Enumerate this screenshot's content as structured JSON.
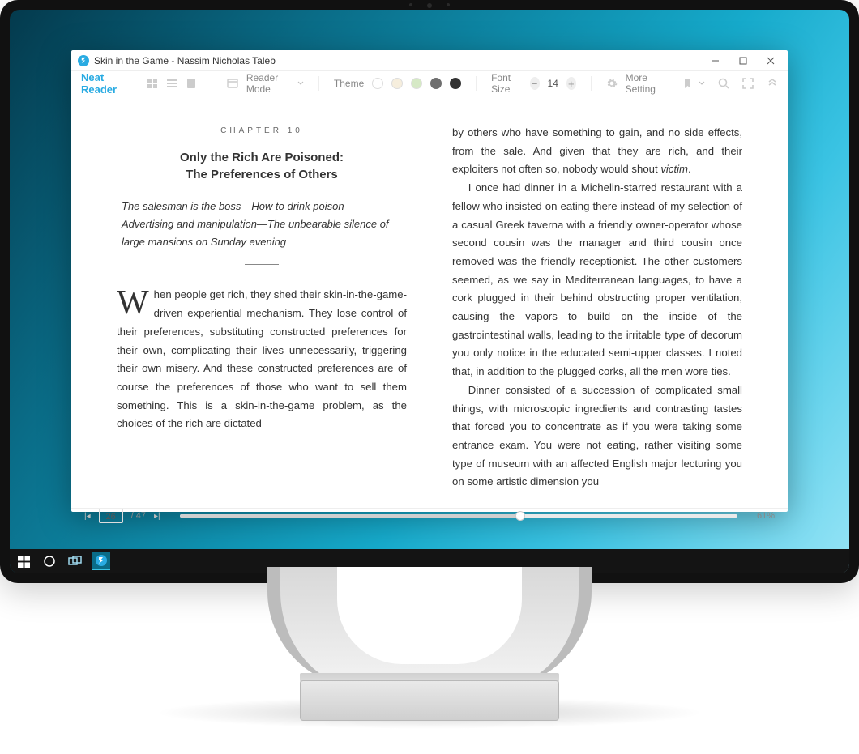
{
  "window": {
    "title": "Skin in the Game - Nassim Nicholas Taleb"
  },
  "toolbar": {
    "brand": "Neat Reader",
    "reader_mode_label": "Reader Mode",
    "theme_label": "Theme",
    "font_size_label": "Font Size",
    "font_size_value": "14",
    "more_setting_label": "More Setting",
    "theme_swatches": [
      "#ffffff",
      "#f6eedd",
      "#d6e9c6",
      "#6f6f6f",
      "#333333"
    ]
  },
  "content": {
    "chapter_label": "CHAPTER 10",
    "chapter_title_line1": "Only the Rich Are Poisoned:",
    "chapter_title_line2": "The Preferences of Others",
    "epigraph": "The salesman is the boss—How to drink poison—Advertising and manipulation—The unbearable silence of large mansions on Sunday evening",
    "dropcap": "W",
    "left_body": "hen people get rich, they shed their skin-in-the-game-driven experiential mechanism. They lose control of their preferences, substituting constructed preferences for their own, complicating their lives unnecessarily, triggering their own misery. And these constructed preferences are of course the preferences of those who want to sell them something. This is a skin-in-the-game problem, as the choices of the rich are dictated",
    "right_p1_a": "by others who have something to gain, and no side effects, from the sale. And given that they are rich, and their exploiters not often so, nobody would shout ",
    "right_p1_italic": "victim",
    "right_p1_b": ".",
    "right_p2": "I once had dinner in a Michelin-starred restaurant with a fellow who insisted on eating there instead of my selection of a casual Greek taverna with a friendly owner-operator whose second cousin was the manager and third cousin once removed was the friendly receptionist. The other customers seemed, as we say in Mediterranean languages, to have a cork plugged in their behind obstructing proper ventilation, causing the vapors to build on the inside of the gastrointestinal walls, leading to the irritable type of decorum you only notice in the educated semi-upper classes. I noted that, in addition to the plugged corks, all the men wore ties.",
    "right_p3": "Dinner consisted of a succession of complicated small things, with microscopic ingredients and contrasting tastes that forced you to concentrate as if you were taking some entrance exam. You were not eating, rather visiting some type of museum with an affected English major lecturing you on some artistic dimension you"
  },
  "footer": {
    "current_page": "26",
    "total_pages": "47",
    "page_sep": " / ",
    "progress_percent": "61%",
    "progress_value": 61
  }
}
